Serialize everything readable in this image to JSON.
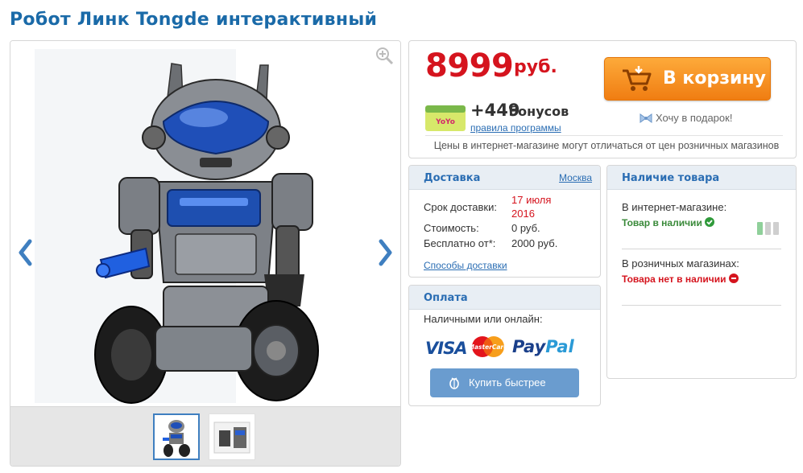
{
  "product": {
    "title": "Робот Линк Tongde интерактивный"
  },
  "gallery": {
    "zoom_icon": "zoom-in-icon",
    "prev_icon": "chevron-left-icon",
    "next_icon": "chevron-right-icon",
    "thumbnails": [
      "robot-front",
      "robot-box"
    ],
    "selected_thumbnail": 0
  },
  "price": {
    "amount": "8999",
    "currency": "руб.",
    "add_to_cart": "В корзину",
    "bonus_amount": "+449",
    "bonus_word": "бонусов",
    "bonus_rules": "правила программы",
    "gift": "Хочу в подарок!",
    "note": "Цены в интернет-магазине могут отличаться от цен розничных магазинов"
  },
  "delivery": {
    "header": "Доставка",
    "city": "Москва",
    "term_label": "Срок доставки:",
    "term_value_1": "17 июля",
    "term_value_2": "2016",
    "cost_label": "Стоимость:",
    "cost_value": "0 руб.",
    "free_label": "Бесплатно от*:",
    "free_value": "2000 руб.",
    "methods_link": "Способы доставки"
  },
  "payment": {
    "header": "Оплата",
    "methods_text": "Наличными или онлайн:",
    "logos": [
      "VISA",
      "MasterCard",
      "PayPal"
    ],
    "visa": "VISA",
    "mastercard": "MasterCard",
    "paypal_1": "Pay",
    "paypal_2": "Pal",
    "quick_buy": "Купить быстрее"
  },
  "stock": {
    "header": "Наличие товара",
    "online_label": "В интернет-магазине:",
    "online_status": "Товар в наличии",
    "retail_label": "В розничных магазинах:",
    "retail_status": "Товара нет в наличии"
  },
  "colors": {
    "brand_blue": "#1a6aa8",
    "price_red": "#d5141e",
    "cart_orange": "#f07d12",
    "in_stock_green": "#3a8a3a"
  }
}
